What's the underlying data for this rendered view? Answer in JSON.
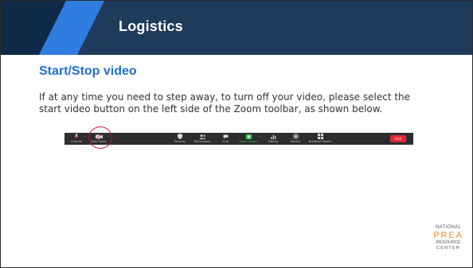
{
  "header": {
    "title": "Logistics",
    "colors": {
      "bar": "#1e3b5c",
      "stripe": "#0e2a47",
      "accent": "#2f7de1"
    }
  },
  "content": {
    "subtitle": "Start/Stop video",
    "paragraph": "If at any time you need to step away, to turn off your video, please select the start video button on the left side of the Zoom toolbar, as shown below."
  },
  "toolbar": {
    "unmute": {
      "label": "Unmute",
      "icon": "microphone-muted-icon"
    },
    "start_video": {
      "label": "Start Video",
      "icon": "video-off-icon"
    },
    "security": {
      "label": "Security",
      "icon": "shield-icon"
    },
    "participants": {
      "label": "Participants",
      "icon": "people-icon"
    },
    "chat": {
      "label": "Chat",
      "icon": "chat-bubble-icon"
    },
    "share_screen": {
      "label": "Share Screen",
      "icon": "share-screen-icon"
    },
    "polling": {
      "label": "Polling",
      "icon": "bar-chart-icon"
    },
    "record": {
      "label": "Record",
      "icon": "record-icon"
    },
    "breakout_rooms": {
      "label": "Breakout Rooms",
      "icon": "grid-icon"
    },
    "end_label": "End"
  },
  "logo": {
    "line1": "NATIONAL",
    "line2": "PREA",
    "line3": "RESOURCE",
    "line4": "CENTER"
  }
}
